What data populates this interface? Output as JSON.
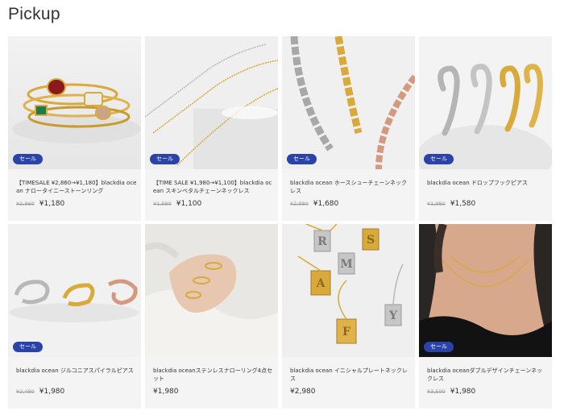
{
  "section_title": "Pickup",
  "products": [
    {
      "name": "【TIMESALE ¥2,860→¥1,180】blackdia ocean ナロータイニーストーンリング",
      "old_price": "¥2,860",
      "price": "¥1,180",
      "badge": "セール"
    },
    {
      "name": "【TIME SALE ¥1,980→¥1,100】blackdia ocean スキンベタルチェーンネックレス",
      "old_price": "¥1,980",
      "price": "¥1,100",
      "badge": "セール"
    },
    {
      "name": "blackdia ocean ホースシューチェーンネックレス",
      "old_price": "¥2,980",
      "price": "¥1,680",
      "badge": "セール"
    },
    {
      "name": "blackdia ocean ドロップフックピアス",
      "old_price": "¥1,980",
      "price": "¥1,580",
      "badge": "セール"
    },
    {
      "name": "blackdia ocean ジルコニアスパイラルピアス",
      "old_price": "¥2,480",
      "price": "¥1,980",
      "badge": "セール"
    },
    {
      "name": "blackdia oceanステンレスナローリング4点セット",
      "old_price": "",
      "price": "¥1,980",
      "badge": ""
    },
    {
      "name": "blackdia ocean イニシャルプレートネックレス",
      "old_price": "",
      "price": "¥2,980",
      "badge": ""
    },
    {
      "name": "blackdia oceanダブルデザインチェーンネックレス",
      "old_price": "¥3,500",
      "price": "¥1,980",
      "badge": "セール"
    }
  ],
  "plate_letters": [
    "R",
    "S",
    "M",
    "A",
    "F",
    "Y"
  ],
  "colors": {
    "badge": "#2a43a8",
    "gold": "#d9a93a",
    "silver": "#b8b8b8",
    "rose": "#d49a80"
  }
}
